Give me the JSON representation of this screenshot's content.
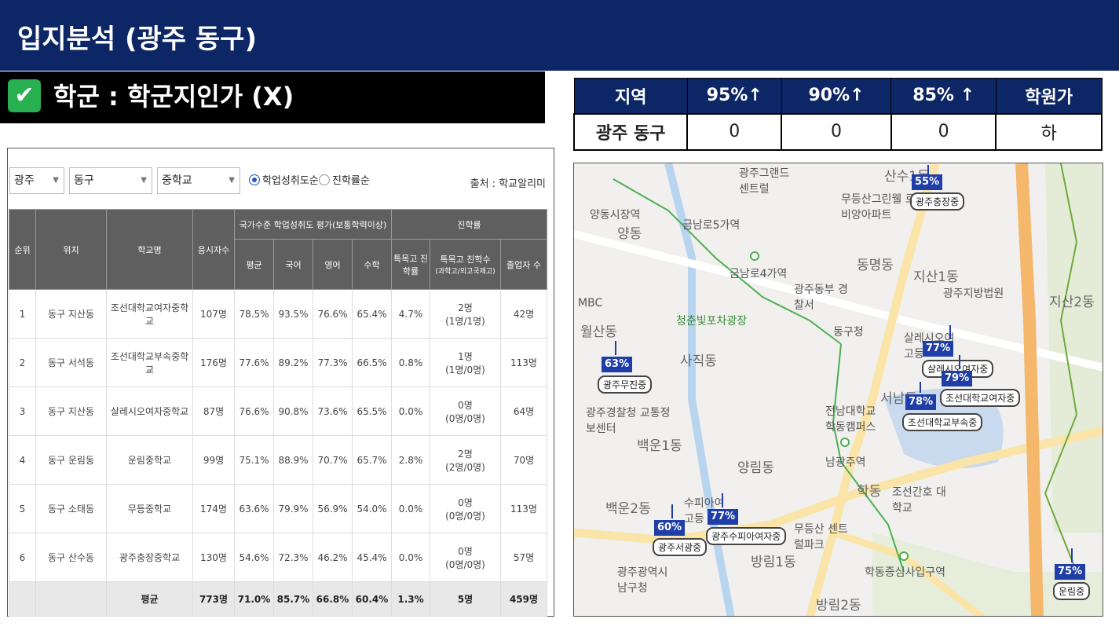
{
  "header": {
    "title": "입지분석 (광주 동구)"
  },
  "section": {
    "check": "✔",
    "title": "학군 : 학군지인가 (X)"
  },
  "summary": {
    "headers": [
      "지역",
      "95%↑",
      "90%↑",
      "85% ↑",
      "학원가"
    ],
    "row": [
      "광주 동구",
      "0",
      "0",
      "0",
      "하"
    ]
  },
  "filters": {
    "city": "광주",
    "district": "동구",
    "level": "중학교",
    "radio1": "학업성취도순",
    "radio2": "진학률순",
    "source": "출처 : 학교알리미"
  },
  "table": {
    "group1": "국가수준 학업성취도 평가(보통학력이상)",
    "group2": "진학률",
    "h_rank": "순위",
    "h_loc": "위치",
    "h_school": "학교명",
    "h_takers": "응시자수",
    "h_avg": "평균",
    "h_kor": "국어",
    "h_eng": "영어",
    "h_math": "수학",
    "h_special_rate": "특목고 진학률",
    "h_special_count": "특목고 진학수",
    "h_special_count_sub": "(과학고/외고국제고)",
    "h_grads": "졸업자 수",
    "rows": [
      {
        "rank": "1",
        "loc": "동구 지산동",
        "school": "조선대학교여자중학교",
        "takers": "107명",
        "avg": "78.5%",
        "kor": "93.5%",
        "eng": "76.6%",
        "math": "65.4%",
        "rate": "4.7%",
        "count": "2명",
        "count_sub": "(1명/1명)",
        "grads": "42명"
      },
      {
        "rank": "2",
        "loc": "동구 서석동",
        "school": "조선대학교부속중학교",
        "takers": "176명",
        "avg": "77.6%",
        "kor": "89.2%",
        "eng": "77.3%",
        "math": "66.5%",
        "rate": "0.8%",
        "count": "1명",
        "count_sub": "(1명/0명)",
        "grads": "113명"
      },
      {
        "rank": "3",
        "loc": "동구 지산동",
        "school": "살레시오여자중학교",
        "takers": "87명",
        "avg": "76.6%",
        "kor": "90.8%",
        "eng": "73.6%",
        "math": "65.5%",
        "rate": "0.0%",
        "count": "0명",
        "count_sub": "(0명/0명)",
        "grads": "64명"
      },
      {
        "rank": "4",
        "loc": "동구 운림동",
        "school": "운림중학교",
        "takers": "99명",
        "avg": "75.1%",
        "kor": "88.9%",
        "eng": "70.7%",
        "math": "65.7%",
        "rate": "2.8%",
        "count": "2명",
        "count_sub": "(2명/0명)",
        "grads": "70명"
      },
      {
        "rank": "5",
        "loc": "동구 소태동",
        "school": "무등중학교",
        "takers": "174명",
        "avg": "63.6%",
        "kor": "79.9%",
        "eng": "56.9%",
        "math": "54.0%",
        "rate": "0.0%",
        "count": "0명",
        "count_sub": "(0명/0명)",
        "grads": "113명"
      },
      {
        "rank": "6",
        "loc": "동구 산수동",
        "school": "광주충장중학교",
        "takers": "130명",
        "avg": "54.6%",
        "kor": "72.3%",
        "eng": "46.2%",
        "math": "45.4%",
        "rate": "0.0%",
        "count": "0명",
        "count_sub": "(0명/0명)",
        "grads": "57명"
      }
    ],
    "avg_row": {
      "label": "평균",
      "takers": "773명",
      "avg": "71.0%",
      "kor": "85.7%",
      "eng": "66.8%",
      "math": "60.4%",
      "rate": "1.3%",
      "count": "5명",
      "grads": "459명"
    }
  },
  "map": {
    "labels": [
      "양동시장역",
      "양동",
      "금남로5가역",
      "금남로4가역",
      "광주그랜드 센트럴",
      "무등산그린웰 로제비앙아파트",
      "산수1동",
      "동명동",
      "지산1동",
      "광주지방법원",
      "지산2동",
      "MBC",
      "월산동",
      "청춘빛포차광장",
      "광주동부 경찰서",
      "동구청",
      "사직동",
      "살레시오여 고등",
      "서남동",
      "광주경찰청 교통정보센터",
      "백운1동",
      "전남대학교 학동캠퍼스",
      "양림동",
      "남광주역",
      "학동",
      "조선간호 대학교",
      "백운2동",
      "수피아여 고등",
      "무등산 센트럴파크",
      "방림1동",
      "광주광역시 남구청",
      "학동증심사입구역",
      "방림2동"
    ],
    "schools": [
      {
        "pct": "55%",
        "name": "광주충장중"
      },
      {
        "pct": "63%",
        "name": "광주무진중"
      },
      {
        "pct": "77%",
        "name": "살레시오여자중"
      },
      {
        "pct": "79%",
        "name": "조선대학교여자중"
      },
      {
        "pct": "78%",
        "name": "조선대학교부속중"
      },
      {
        "pct": "60%",
        "name": "광주서광중"
      },
      {
        "pct": "77%",
        "name": "광주수피아여자중"
      },
      {
        "pct": "75%",
        "name": "운림중"
      }
    ]
  }
}
